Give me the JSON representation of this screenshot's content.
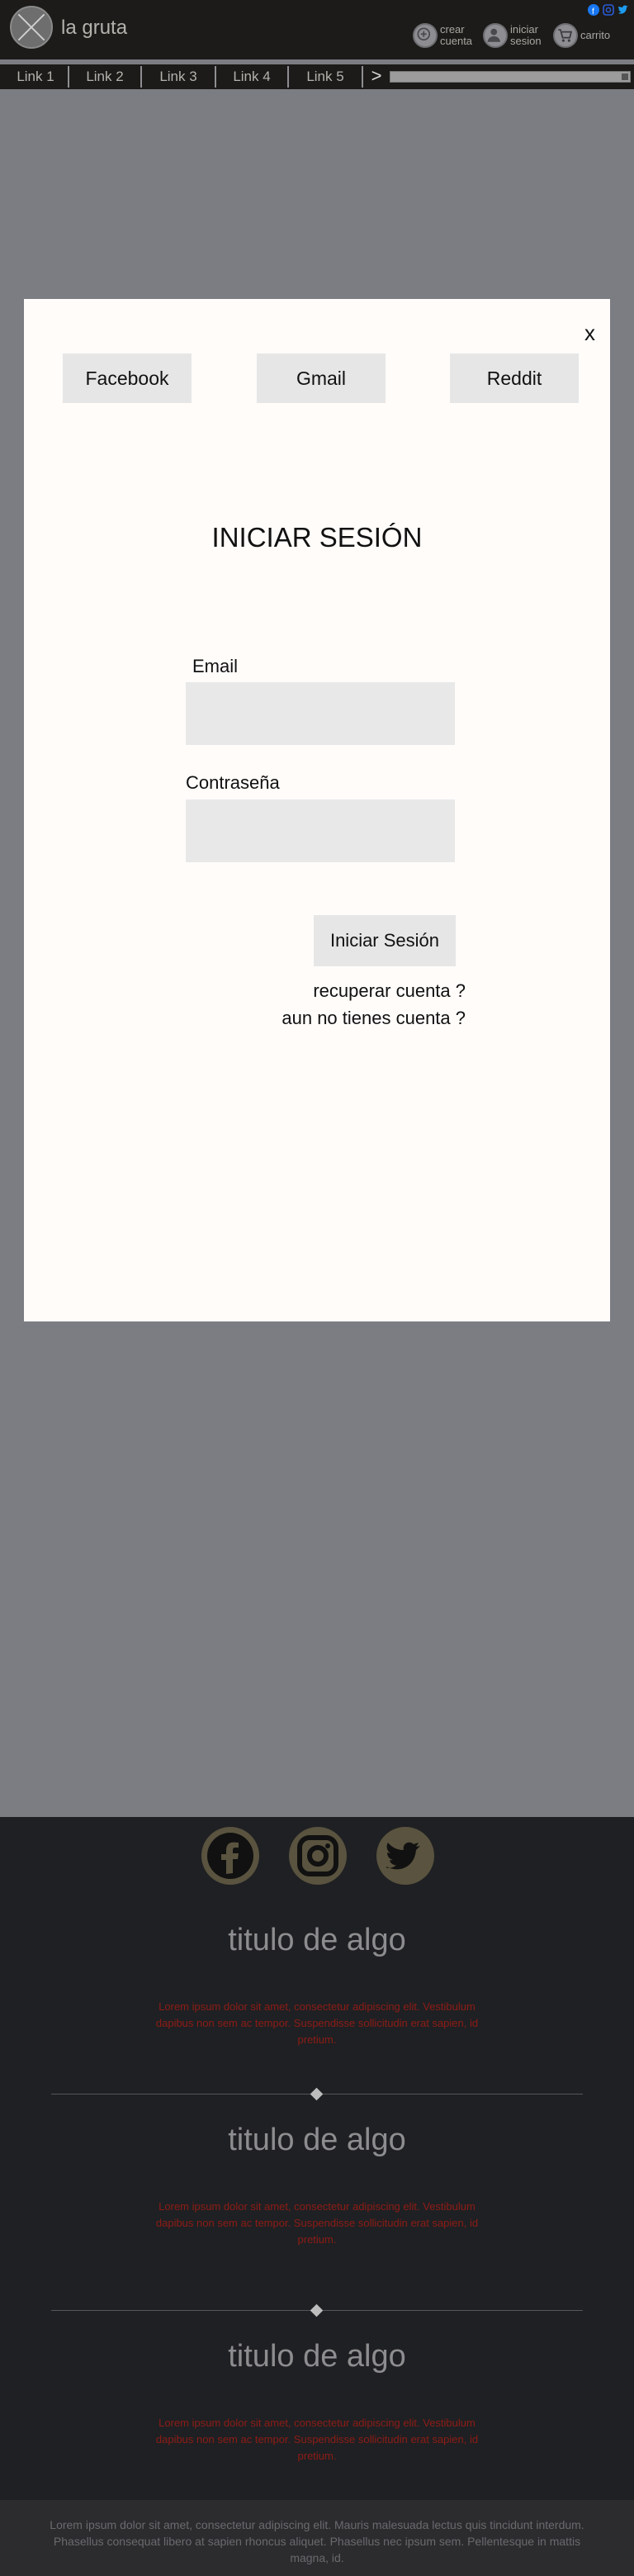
{
  "header": {
    "brand": "la gruta",
    "actions": {
      "create_account": "crear cuenta",
      "login": "iniciar sesion",
      "cart": "carrito"
    },
    "social_icons": [
      "facebook-icon",
      "instagram-icon",
      "twitter-icon"
    ]
  },
  "nav": {
    "links": [
      "Link 1",
      "Link 2",
      "Link 3",
      "Link 4",
      "Link 5"
    ],
    "next_icon": ">"
  },
  "modal": {
    "close": "x",
    "oauth_buttons": [
      "Facebook",
      "Gmail",
      "Reddit"
    ],
    "title": "INICIAR SESIÓN",
    "email_label": "Email",
    "password_label": "Contraseña",
    "submit": "Iniciar Sesión",
    "recover": "recuperar cuenta ?",
    "no_account": "aun no tienes cuenta ?"
  },
  "footer": {
    "social_icons": [
      "facebook-icon",
      "instagram-icon",
      "twitter-icon"
    ],
    "sections": [
      {
        "title": "titulo de algo",
        "text": "Lorem ipsum dolor sit amet, consectetur adipiscing elit. Vestibulum dapibus non sem ac tempor. Suspendisse sollicitudin erat sapien, id pretium."
      },
      {
        "title": "titulo de algo",
        "text": "Lorem ipsum dolor sit amet, consectetur adipiscing elit. Vestibulum dapibus non sem ac tempor. Suspendisse sollicitudin erat sapien, id pretium."
      },
      {
        "title": "titulo de algo",
        "text": "Lorem ipsum dolor sit amet, consectetur adipiscing elit. Vestibulum dapibus non sem ac tempor. Suspendisse sollicitudin erat sapien, id pretium."
      }
    ],
    "bottom_text": "Lorem ipsum dolor sit amet, consectetur adipiscing elit. Mauris malesuada lectus quis tincidunt interdum. Phasellus consequat libero at sapien rhoncus aliquet. Phasellus nec ipsum sem. Pellentesque in mattis magna, id."
  },
  "colors": {
    "header_bg": "#1c1b19",
    "overlay_bg": "#7c7d82",
    "footer_bg": "#1f2023",
    "footer_text_red": "#8d1c16",
    "social_circle": "#59533f"
  }
}
